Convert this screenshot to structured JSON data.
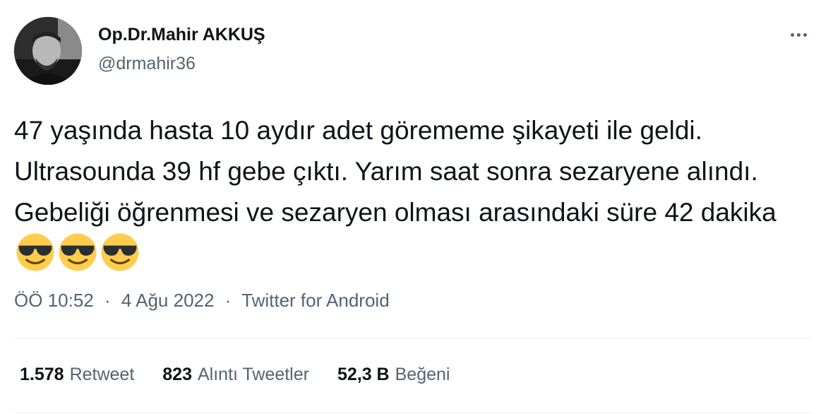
{
  "author": {
    "name": "Op.Dr.Mahir AKKUŞ",
    "handle": "@drmahir36",
    "avatar_icon": "profile-photo"
  },
  "more_icon": "more-horizontal-icon",
  "tweet": {
    "text": "47 yaşında hasta 10 aydır adet görememe şikayeti ile geldi. Ultrasounda 39 hf gebe çıktı. Yarım saat sonra sezaryene alındı. Gebeliği öğrenmesi ve sezaryen olması arasındaki süre 42 dakika",
    "emoji": [
      "smiling-face-with-sunglasses",
      "smiling-face-with-sunglasses",
      "smiling-face-with-sunglasses"
    ]
  },
  "meta": {
    "time": "ÖÖ 10:52",
    "date": "4 Ağu 2022",
    "source": "Twitter for Android",
    "separator": "·"
  },
  "stats": {
    "retweets": {
      "count": "1.578",
      "label": "Retweet"
    },
    "quotes": {
      "count": "823",
      "label": "Alıntı Tweetler"
    },
    "likes": {
      "count": "52,3 B",
      "label": "Beğeni"
    }
  },
  "colors": {
    "text": "#0f1419",
    "secondary": "#536471",
    "divider": "#eff3f4",
    "emoji_face": "#ffcc4d"
  }
}
